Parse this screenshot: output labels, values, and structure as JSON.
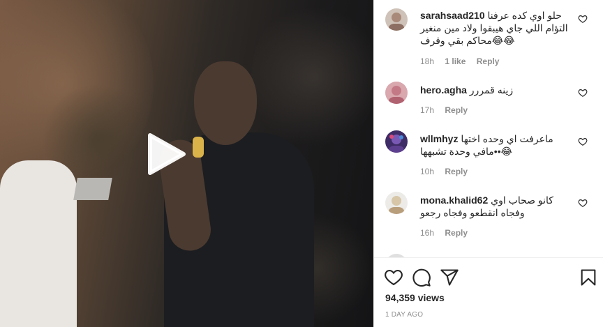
{
  "video": {
    "play_icon": "play-icon"
  },
  "comments": [
    {
      "username": "sarahsaad210",
      "text": "حلو اوي كده عرفنا التؤام اللي جاي هيبقوا ولاد مين منغير محاكم بقي وقرف😂😂",
      "time": "18h",
      "likes": "1 like",
      "reply": "Reply",
      "avatar_color": "#a98a7a"
    },
    {
      "username": "hero.agha",
      "text": "زينه قمررر",
      "time": "17h",
      "likes": "",
      "reply": "Reply",
      "avatar_color": "#c47a86"
    },
    {
      "username": "wllmhyz",
      "text": "ماعرفت اي وحده اختها ••مافي وحدة تشبهها😂",
      "time": "10h",
      "likes": "",
      "reply": "Reply",
      "avatar_color": "#5d3f8f"
    },
    {
      "username": "mona.khalid62",
      "text": "كانو صحاب اوي وفجاه انقطعو وفجاه رجعو",
      "time": "16h",
      "likes": "",
      "reply": "Reply",
      "avatar_color": "#d7c6a8"
    }
  ],
  "actions": {
    "like_icon": "heart-icon",
    "comment_icon": "comment-icon",
    "share_icon": "share-icon",
    "save_icon": "bookmark-icon"
  },
  "stats": {
    "views": "94,359 views",
    "posted": "1 DAY AGO"
  }
}
